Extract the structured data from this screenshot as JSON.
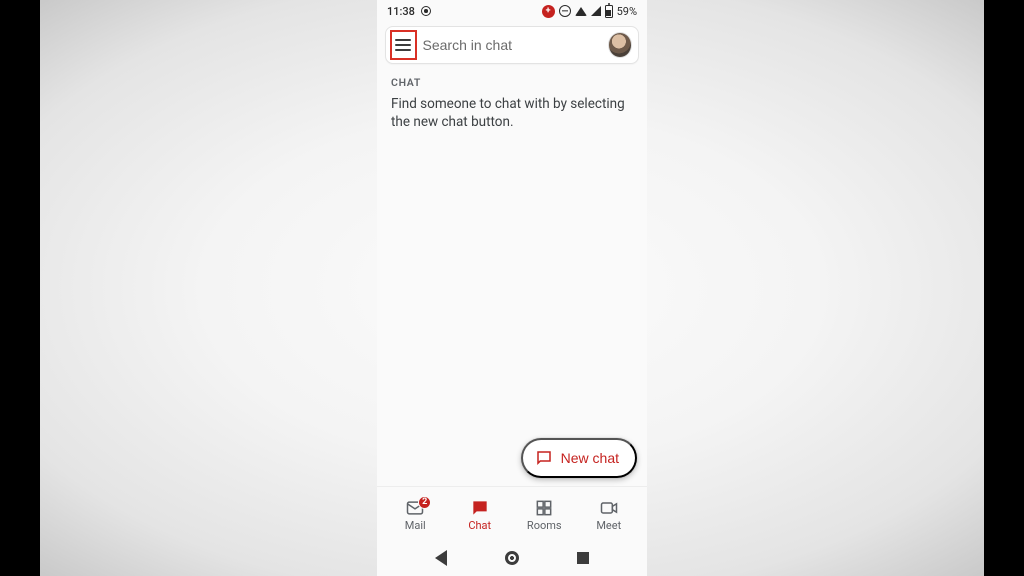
{
  "status": {
    "time": "11:38",
    "battery_pct": "59%",
    "notif_badge": "+"
  },
  "search": {
    "placeholder": "Search in chat"
  },
  "content": {
    "section_label": "CHAT",
    "empty_message": "Find someone to chat with by selecting the new chat button."
  },
  "fab": {
    "label": "New chat"
  },
  "bottom_nav": {
    "items": [
      {
        "label": "Mail",
        "badge": "2"
      },
      {
        "label": "Chat",
        "badge": null
      },
      {
        "label": "Rooms",
        "badge": null
      },
      {
        "label": "Meet",
        "badge": null
      }
    ],
    "active_index": 1
  },
  "colors": {
    "accent": "#c5221f",
    "highlight_box": "#d93025",
    "text_muted": "#5f6368"
  }
}
